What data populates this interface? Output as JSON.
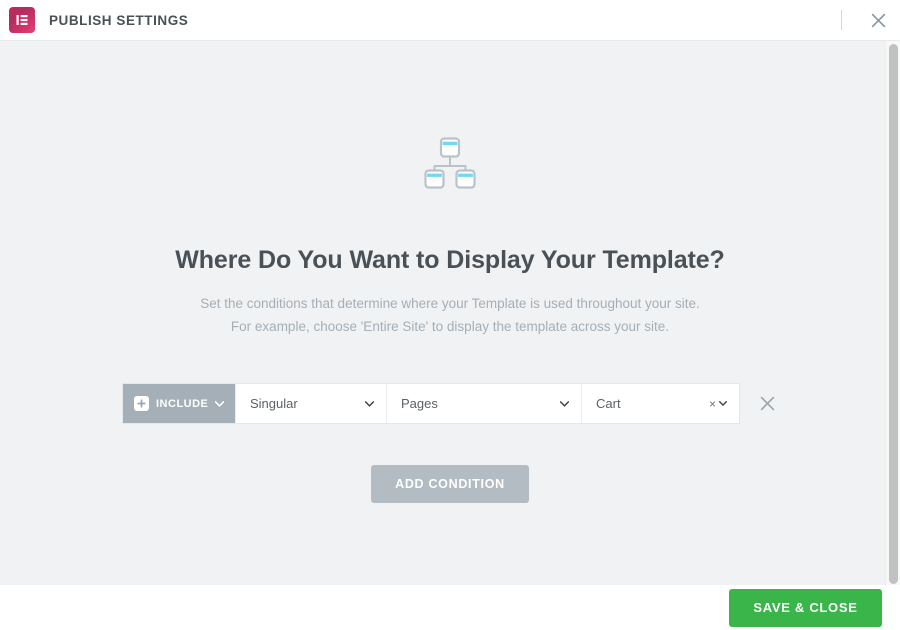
{
  "header": {
    "title": "PUBLISH SETTINGS",
    "logo_icon": "elementor-logo-icon",
    "close_icon": "close-icon"
  },
  "panel": {
    "illustration_icon": "sitemap-icon",
    "title": "Where Do You Want to Display Your Template?",
    "subtitle_line1": "Set the conditions that determine where your Template is used throughout your site.",
    "subtitle_line2": "For example, choose 'Entire Site' to display the template across your site."
  },
  "conditions": {
    "rows": [
      {
        "type_label": "INCLUDE",
        "type_icon": "plus-icon",
        "type_caret_icon": "chevron-down-icon",
        "selects": [
          {
            "name": "singular",
            "value": "Singular",
            "caret_icon": "chevron-down-icon"
          },
          {
            "name": "pages",
            "value": "Pages",
            "caret_icon": "chevron-down-icon"
          },
          {
            "name": "cart",
            "value": "Cart",
            "clear_icon": "×",
            "caret_icon": "chevron-down-icon"
          }
        ],
        "remove_icon": "close-icon"
      }
    ],
    "add_button_label": "ADD CONDITION"
  },
  "footer": {
    "save_label": "SAVE & CLOSE"
  },
  "colors": {
    "brand_pink": "#c1295b",
    "accent_green": "#39b54a",
    "include_gray": "#a4afb7",
    "add_condition_gray": "#b3bcc3",
    "text_dark": "#495157",
    "text_muted": "#a4afb7",
    "body_bg": "#f1f2f3",
    "icon_blue": "#71d7f7"
  }
}
